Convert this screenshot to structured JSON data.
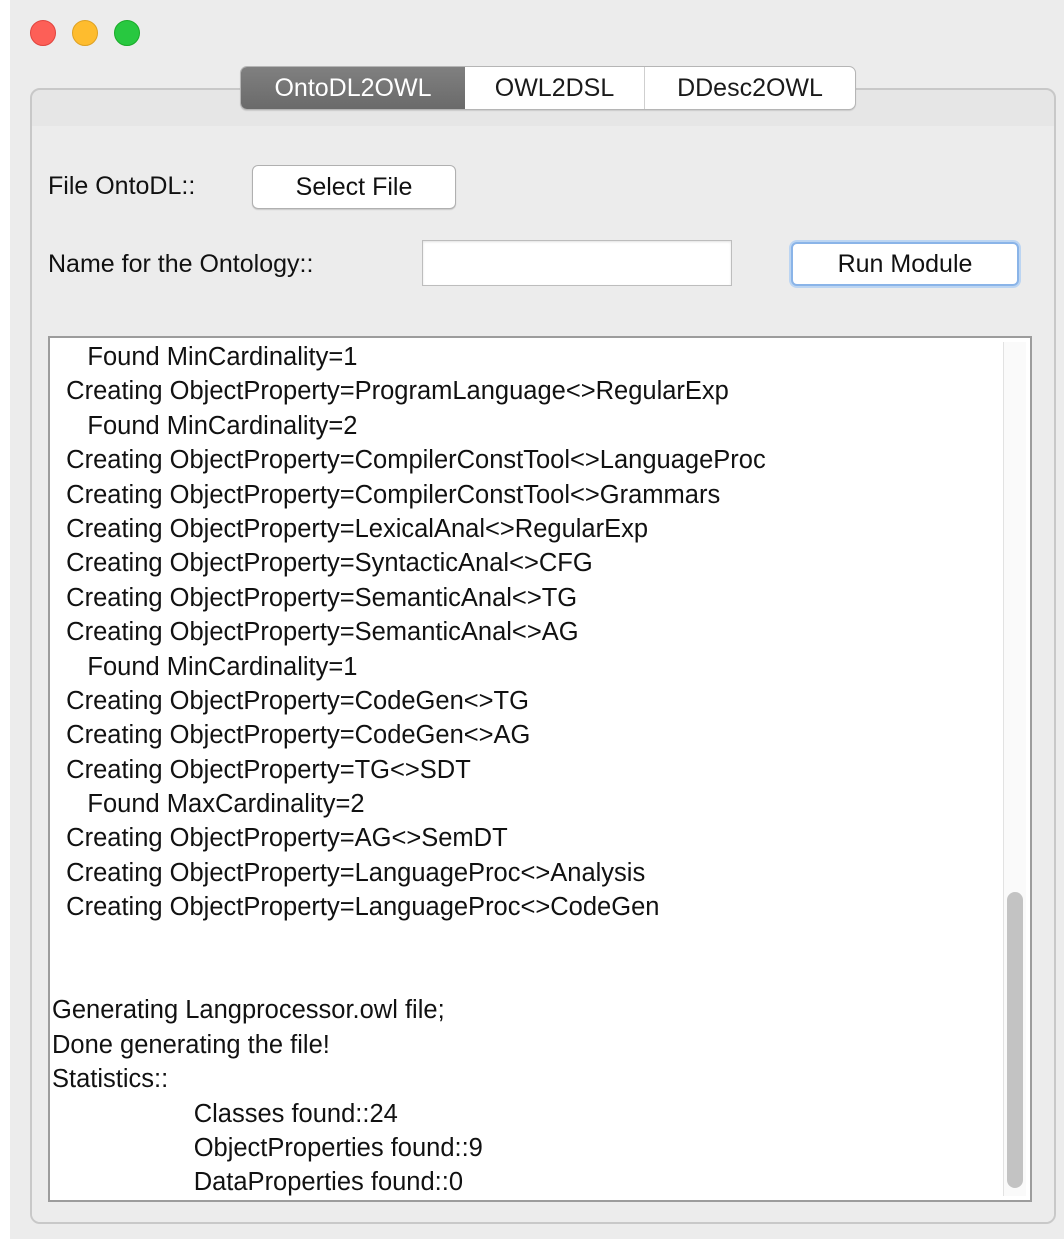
{
  "window": {
    "controls": [
      "close-button",
      "minimize-button",
      "maximize-button"
    ]
  },
  "tabs": [
    {
      "label": "OntoDL2OWL",
      "active": true
    },
    {
      "label": "OWL2DSL",
      "active": false
    },
    {
      "label": "DDesc2OWL",
      "active": false
    }
  ],
  "form": {
    "file_label": "File OntoDL::",
    "select_file_label": "Select File",
    "name_label": "Name for the Ontology::",
    "name_value": "",
    "run_label": "Run Module"
  },
  "log": {
    "lines": [
      "     Found MinCardinality=1",
      "  Creating ObjectProperty=ProgramLanguage<>RegularExp",
      "     Found MinCardinality=2",
      "  Creating ObjectProperty=CompilerConstTool<>LanguageProc",
      "  Creating ObjectProperty=CompilerConstTool<>Grammars",
      "  Creating ObjectProperty=LexicalAnal<>RegularExp",
      "  Creating ObjectProperty=SyntacticAnal<>CFG",
      "  Creating ObjectProperty=SemanticAnal<>TG",
      "  Creating ObjectProperty=SemanticAnal<>AG",
      "     Found MinCardinality=1",
      "  Creating ObjectProperty=CodeGen<>TG",
      "  Creating ObjectProperty=CodeGen<>AG",
      "  Creating ObjectProperty=TG<>SDT",
      "     Found MaxCardinality=2",
      "  Creating ObjectProperty=AG<>SemDT",
      "  Creating ObjectProperty=LanguageProc<>Analysis",
      "  Creating ObjectProperty=LanguageProc<>CodeGen",
      "",
      "",
      "Generating Langprocessor.owl file;",
      "Done generating the file!",
      "Statistics::",
      "                    Classes found::24",
      "                    ObjectProperties found::9",
      "                    DataProperties found::0"
    ],
    "scroll_position": 1.0
  }
}
